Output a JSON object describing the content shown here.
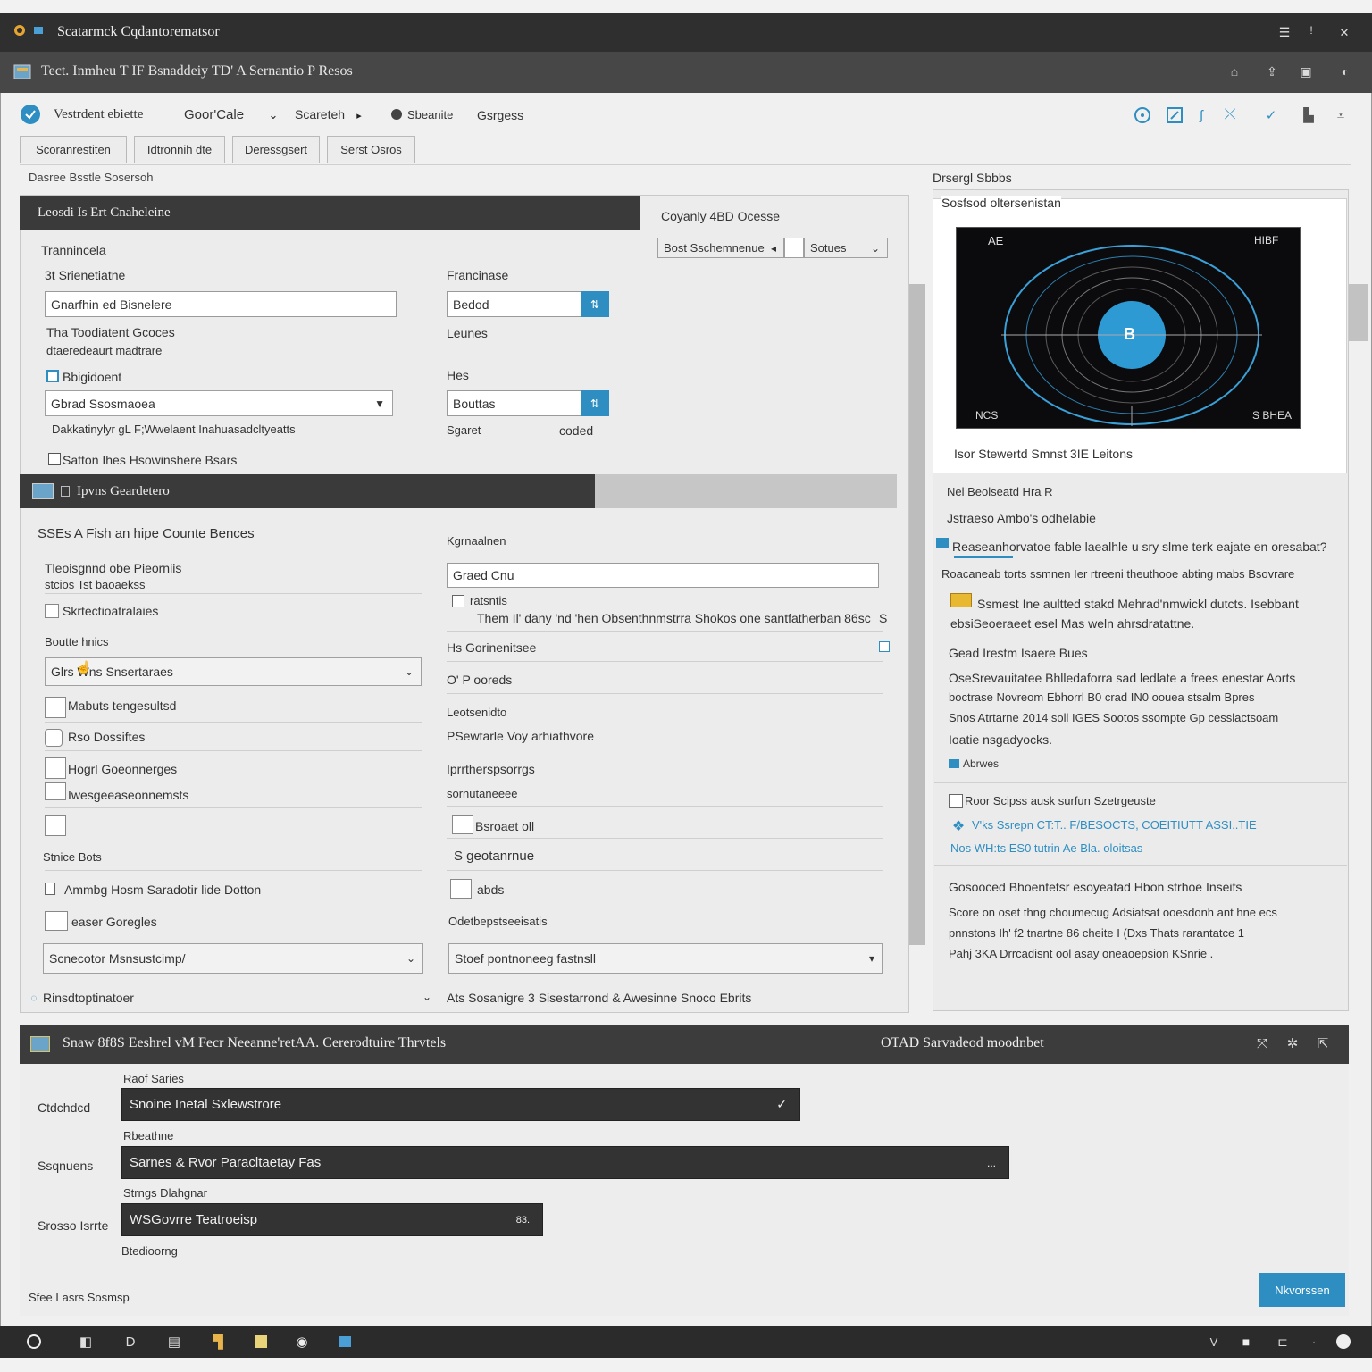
{
  "window": {
    "title": "Scatarmck Cqdantorematsor",
    "subtitle": "Tect. Inmheu T IF Bsnaddeiy TD' A Sernantio P Resos"
  },
  "toolbar": {
    "app_name": "Vestrdent ebiette",
    "menu_1": "Goor'Cale",
    "menu_2": "Scareteh",
    "menu_3_status": "Sbeanite",
    "menu_4": "Gsrgess"
  },
  "tabs": [
    "Scoranrestiten",
    "Idtronnih dte",
    "Deressgsert",
    "Serst Osros"
  ],
  "breadcrumb": "Dasree Bsstle Sosersoh",
  "section1": {
    "header": "Leosdi Is Ert Cnaheleine",
    "group_title": "Trannincela",
    "field1_label": "3t Srienetiatne",
    "field1_value": "Gnarfhin ed Bisnelere",
    "hint1_line1": "Tha Toodiatent Gcoces",
    "hint1_line2": "dtaeredeaurt madtrare",
    "check_label": "Bbigidoent",
    "select1_value": "Gbrad Ssosmaoea",
    "hint2": "Dakkatinylyr gL F;Wwelaent Inahuasadcltyeatts",
    "footnote": "Satton Ihes Hsowinshere Bsars",
    "field2_label": "Francinase",
    "field2_value": "Bedod",
    "field2_hint": "Leunes",
    "field3_label": "Hes",
    "field3_value": "Bouttas",
    "field3_hint_a": "Sgaret",
    "field3_hint_b": "coded"
  },
  "side_options": {
    "title": "Coyanly 4BD Ocesse",
    "select_a": "Bost Sschemnenue",
    "select_b": "Sotues"
  },
  "section2": {
    "header": "Ipvns Geardetero",
    "subtitle": "SSEs A Fish an hipe Counte Bences",
    "group_title": "Tleoisgnnd obe Pieorniis",
    "group_sub": "stcios Tst baoaekss",
    "check_1": "Skrtectioatralaies",
    "field_label_a": "Boutte hnics",
    "select_a": "Glrs Wns Snsertaraes",
    "check_2": "Mabuts tengesultsd",
    "check_3": "Rso Dossiftes",
    "check_4": "Hogrl Goeonnerges",
    "check_5": "Iwesgeeaseonnemsts",
    "label_b": "Stnice Bots",
    "check_6": "Ammbg Hosm Saradotir lide Dotton",
    "check_7": "easer Goregles",
    "select_b": "Scnecotor Msnsustcimp/",
    "link_text": "Rinsdtoptinatoer",
    "right_label": "Kgrnaalnen",
    "right_input": "Graed Cnu",
    "right_check_1": "ratsntis",
    "right_note": "Them Il' dany 'nd 'hen Obsenthnmstrra Shokos one santfatherban 86sc",
    "right_note_tail": "S",
    "right_label_2": "Hs Gorinenitsee",
    "right_label_3": "O' P ooreds",
    "right_label_4": "Leotsenidto",
    "right_label_5": "PSewtarle Voy arhiathvore",
    "right_label_6": "Iprrtherspsorrgs",
    "right_label_7": "sornutaneeee",
    "right_check_2": "Bsroaet oll",
    "right_label_8": "S geotanrnue",
    "right_check_3": "abds",
    "right_label_9": "Odetbepstseeisatis",
    "right_select": "Stoef pontnoneeg fastnsll",
    "bottom_text": "Ats Sosanigre 3 Sisestarrond & Awesinne Snoco Ebrits"
  },
  "preview": {
    "title": "Drsergl Sbbbs",
    "box_title": "Sosfsod oltersenistan",
    "caption": "Isor Stewertd Smnst 3IE Leitons",
    "screen_tl": "AE",
    "screen_tr": "HIBF",
    "screen_bl": "NCS",
    "screen_br": "S BHEA",
    "center_label": "B"
  },
  "info_panel": {
    "line1": "Nel Beolseatd Hra R",
    "line2": "Jstraeso Ambo's odhelabie",
    "line3": "Reaseanhorvatoe fable laealhle u sry slme terk eajate en oresabat?",
    "line4": "Roacaneab torts ssmnen Ier rtreeni theuthooe abting mabs Bsovrare",
    "note_line1": "Ssmest Ine aultted stakd Mehrad'nmwickl dutcts. Isebbant",
    "note_line2": "ebsiSeoeraeet esel Mas weln ahrsdratattne.",
    "sub_title": "Gead Irestm Isaere Bues",
    "para_line1": "OseSrevauitatee Bhlledaforra sad ledlate a frees enestar Aorts",
    "para_line2": "boctrase Novreom Ebhorrl B0 crad IN0 oouea stsalm Bpres",
    "para_line3": "Snos Atrtarne 2014 soll IGES Sootos ssompte Gp cesslactsoam",
    "para_line4": "Ioatie nsgadyocks.",
    "link_small": "Abrwes",
    "check_label": "Roor Scipss ausk surfun Szetrgeuste",
    "link_line1": "V'ks Ssrepn CT:T.. F/BESOCTS, COEITIUTT ASSI..TIE",
    "link_line2": "Nos WH:ts ES0 tutrin Ae Bla. oloitsas",
    "bottom_title": "Gosooced Bhoentetsr esoyeatad Hbon strhoe Inseifs",
    "bottom_line1": "Score on oset thng choumecug Adsiatsat ooesdonh ant hne ecs",
    "bottom_line2": "pnnstons Ih' f2 tnartne 86 cheite I (Dxs Thats rarantatce 1",
    "bottom_line3": "Pahj 3KA Drrcadisnt ool asay oneaoepsion KSnrie ."
  },
  "bottom_section": {
    "header": "Snaw 8f8S Eeshrel vM Fecr Neeanne'retAA. Cererodtuire Thrvtels",
    "header_right": "OTAD Sarvadeod moodnbet",
    "field1_caption": "Raof Saries",
    "field1_label": "Ctdchdcd",
    "field1_value": "Snoine Inetal Sxlewstrore",
    "field2_caption": "Rbeathne",
    "field2_label": "Ssqnuens",
    "field2_value": "Sarnes & Rvor Paracltaetay Fas",
    "field2_tail": "...",
    "field3_caption": "Strngs Dlahgnar",
    "field3_label": "Srosso Isrrte",
    "field3_value": "WSGovrre Teatroeisp",
    "field3_tail": "83.",
    "field3_hint": "Btedioorng",
    "footer_left": "Sfee Lasrs Sosmsp",
    "primary_button": "Nkvorssen"
  },
  "colors": {
    "accent": "#2e8ec2",
    "dark_header": "#3a3a3a",
    "taskbar": "#2b2b2b"
  }
}
